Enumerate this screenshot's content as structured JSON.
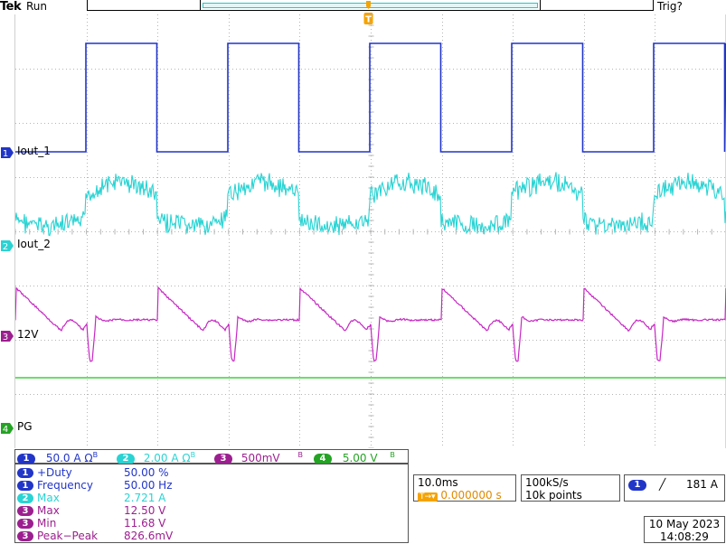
{
  "header": {
    "brand": "Tek",
    "run_state": "Run",
    "trigger_state": "Trig?"
  },
  "trigger_marker_label": "T",
  "channels": [
    {
      "number": "1",
      "label": "Iout_1",
      "color": "#2135c8"
    },
    {
      "number": "2",
      "label": "Iout_2",
      "color": "#2ad3d3"
    },
    {
      "number": "3",
      "label": "12V",
      "color": "#c728c4"
    },
    {
      "number": "4",
      "label": "PG",
      "color": "#3fcf3f"
    }
  ],
  "scales": [
    {
      "channel": "1",
      "value": "50.0 A",
      "suffix": "Ω",
      "bw": "B",
      "sub": "W"
    },
    {
      "channel": "2",
      "value": "2.00 A",
      "suffix": "Ω",
      "bw": "B",
      "sub": "W"
    },
    {
      "channel": "3",
      "value": "500mV",
      "suffix": "",
      "bw": "B",
      "sub": "W"
    },
    {
      "channel": "4",
      "value": "5.00 V",
      "suffix": "",
      "bw": "B",
      "sub": "W"
    }
  ],
  "measurements": [
    {
      "channel": "1",
      "name": "+Duty",
      "value": "50.00 %"
    },
    {
      "channel": "1",
      "name": "Frequency",
      "value": "50.00 Hz"
    },
    {
      "channel": "2",
      "name": "Max",
      "value": "2.721 A"
    },
    {
      "channel": "3",
      "name": "Max",
      "value": "12.50 V"
    },
    {
      "channel": "3",
      "name": "Min",
      "value": "11.68 V"
    },
    {
      "channel": "3",
      "name": "Peak−Peak",
      "value": "826.6mV"
    }
  ],
  "timebase": {
    "scale": "10.0ms",
    "trigger_offset_prefix": "T→▾",
    "trigger_offset": "0.000000 s"
  },
  "acquisition": {
    "sample_rate": "100kS/s",
    "record_length": "10k points"
  },
  "trigger": {
    "source": "1",
    "slope": "╱",
    "level": "181 A"
  },
  "datetime": {
    "date": "10 May 2023",
    "time": "14:08:29"
  },
  "colors": {
    "ch1": "#2135c8",
    "ch2": "#2ad3d3",
    "ch3": "#c728c4",
    "ch4": "#3fcf3f",
    "trigger": "#f5a300",
    "grid": "#a0a0a0"
  }
}
